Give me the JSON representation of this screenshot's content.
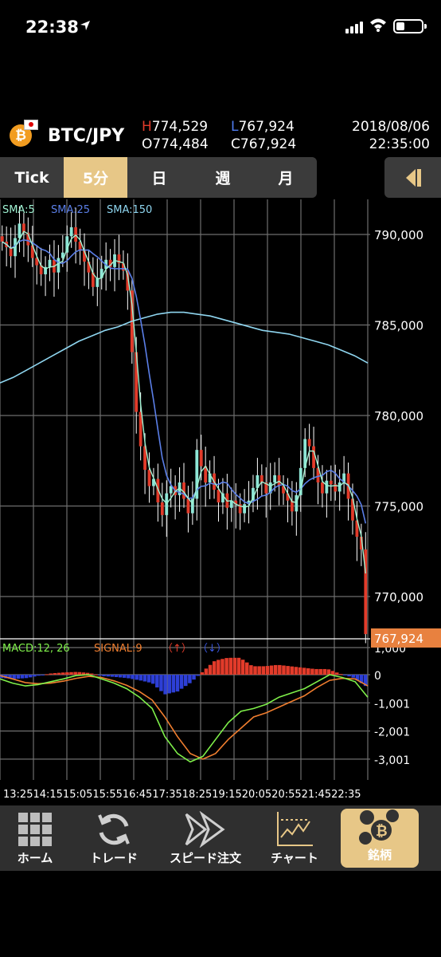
{
  "status_bar": {
    "time": "22:38",
    "location_icon": "location-arrow-icon",
    "signal_icon": "cellular-signal-icon",
    "wifi_icon": "wifi-icon",
    "battery_icon": "battery-icon"
  },
  "header": {
    "pair": "BTC/JPY",
    "high_label": "H",
    "high": "774,529",
    "open_label": "O",
    "open": "774,484",
    "low_label": "L",
    "low": "767,924",
    "close_label": "C",
    "close": "767,924",
    "date": "2018/08/06",
    "time": "22:35:00",
    "colors": {
      "high": "#e23b2a",
      "low": "#4f7cf0"
    }
  },
  "tabs": [
    {
      "label": "Tick",
      "active": false
    },
    {
      "label": "5分",
      "active": true
    },
    {
      "label": "日",
      "active": false
    },
    {
      "label": "週",
      "active": false
    },
    {
      "label": "月",
      "active": false
    }
  ],
  "legend": {
    "sma5": "SMA:5",
    "sma25": "SMA:25",
    "sma150": "SMA:150",
    "macd": "MACD:12, 26",
    "signal": "SIGNAL:9",
    "hist_a": "（↑）",
    "hist_b": "（↓）"
  },
  "price_axis": [
    "790,000",
    "785,000",
    "780,000",
    "775,000",
    "770,000"
  ],
  "current_price": "767,924",
  "macd_axis": [
    "1,000",
    "0",
    "-1,001",
    "-2,001",
    "-3,001"
  ],
  "time_axis": "13:2514:1515:0515:5516:4517:3518:2519:1520:0520:5521:4522:35",
  "chart_data": {
    "type": "candlestick",
    "interval": "5分",
    "ylim": [
      767000,
      792000
    ],
    "time_ticks": [
      "13:25",
      "14:15",
      "15:05",
      "15:55",
      "16:45",
      "17:35",
      "18:25",
      "19:15",
      "20:05",
      "20:55",
      "21:45",
      "22:35"
    ],
    "closes": [
      789600,
      789300,
      788800,
      789800,
      790600,
      790100,
      789400,
      788700,
      788300,
      787800,
      788200,
      788600,
      787900,
      788700,
      789000,
      789900,
      790400,
      789600,
      789100,
      788500,
      787900,
      787100,
      787600,
      788100,
      788600,
      788200,
      788900,
      788400,
      788000,
      786900,
      783500,
      780200,
      778300,
      777000,
      776100,
      776500,
      775200,
      774500,
      775700,
      776100,
      775600,
      776300,
      775400,
      774600,
      775400,
      778100,
      777200,
      776300,
      776800,
      775900,
      775200,
      775700,
      774900,
      775300,
      775100,
      774600,
      775100,
      775300,
      776000,
      776700,
      776300,
      775700,
      776300,
      776700,
      776100,
      775700,
      775300,
      774700,
      775600,
      777100,
      778700,
      778300,
      777100,
      776300,
      775700,
      776400,
      776200,
      775800,
      776300,
      776800,
      775400,
      774200,
      773300,
      772600,
      767924
    ],
    "sma150": [
      781800,
      782100,
      782500,
      782900,
      783300,
      783700,
      784100,
      784400,
      784700,
      784900,
      785200,
      785400,
      785600,
      785700,
      785700,
      785600,
      785500,
      785300,
      785100,
      784900,
      784700,
      784600,
      784500,
      784300,
      784100,
      783900,
      783600,
      783300,
      782900
    ],
    "macd_ylim": [
      -3600,
      1200
    ],
    "macd": [
      -150,
      -300,
      -400,
      -350,
      -250,
      -150,
      -30,
      0,
      -150,
      -300,
      -500,
      -800,
      -1200,
      -2200,
      -2800,
      -3100,
      -2900,
      -2300,
      -1700,
      -1300,
      -1200,
      -1050,
      -800,
      -650,
      -500,
      -250,
      0,
      -100,
      -250,
      -800
    ],
    "signal": [
      -30,
      -150,
      -280,
      -320,
      -300,
      -230,
      -130,
      -60,
      -100,
      -220,
      -380,
      -600,
      -900,
      -1500,
      -2200,
      -2800,
      -3000,
      -2800,
      -2300,
      -1900,
      -1500,
      -1350,
      -1150,
      -950,
      -750,
      -450,
      -200,
      -130,
      -150,
      -400
    ]
  },
  "nav": [
    {
      "label": "ホーム",
      "icon": "grid-icon",
      "active": false
    },
    {
      "label": "トレード",
      "icon": "refresh-icon",
      "active": false
    },
    {
      "label": "スピード注文",
      "icon": "double-chevron-right-icon",
      "active": false
    },
    {
      "label": "チャート",
      "icon": "chart-icon",
      "active": false
    },
    {
      "label": "銘柄",
      "icon": "coins-icon",
      "active": true
    }
  ]
}
